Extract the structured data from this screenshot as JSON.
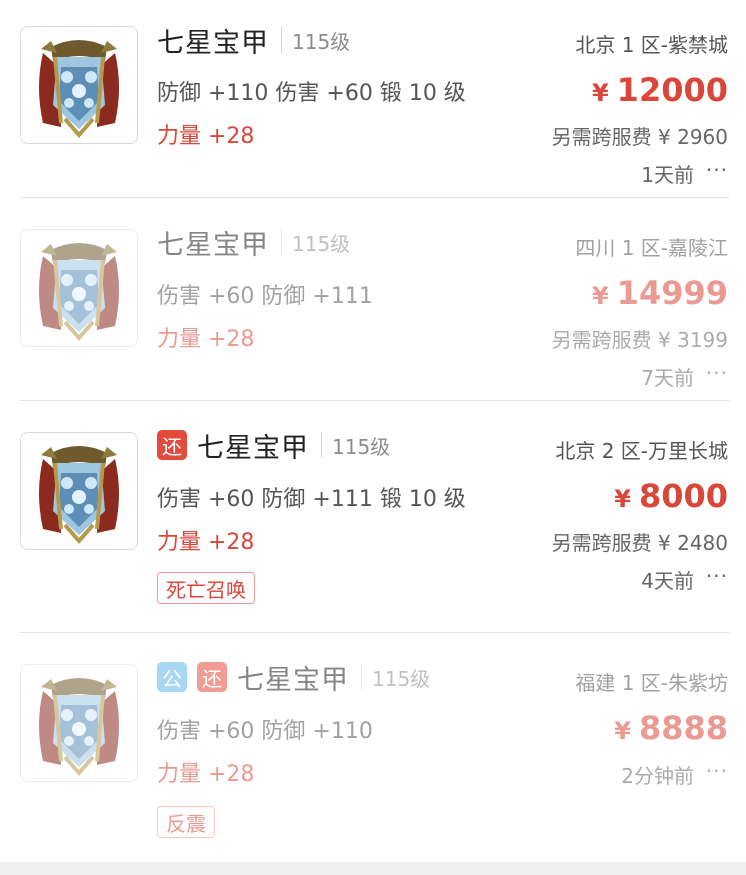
{
  "listings": [
    {
      "title": "七星宝甲",
      "level": "115级",
      "attrs": "防御 +110 伤害 +60 锻 10 级",
      "power": "力量 +28",
      "server": "北京 1 区-紫禁城",
      "currency": "¥",
      "price": "12000",
      "fee": "另需跨服费 ¥ 2960",
      "time": "1天前",
      "more": "···"
    },
    {
      "title": "七星宝甲",
      "level": "115级",
      "attrs": "伤害 +60 防御 +111",
      "power": "力量 +28",
      "server": "四川 1 区-嘉陵江",
      "currency": "¥",
      "price": "14999",
      "fee": "另需跨服费 ¥ 3199",
      "time": "7天前",
      "more": "···"
    },
    {
      "tags": [
        "还"
      ],
      "title": "七星宝甲",
      "level": "115级",
      "attrs": "伤害 +60 防御 +111 锻 10 级",
      "power": "力量 +28",
      "skill": "死亡召唤",
      "server": "北京 2 区-万里长城",
      "currency": "¥",
      "price": "8000",
      "fee": "另需跨服费 ¥ 2480",
      "time": "4天前",
      "more": "···"
    },
    {
      "tags": [
        "公",
        "还"
      ],
      "title": "七星宝甲",
      "level": "115级",
      "attrs": "伤害 +60 防御 +110",
      "power": "力量 +28",
      "skill": "反震",
      "server": "福建 1 区-朱紫坊",
      "currency": "¥",
      "price": "8888",
      "time": "2分钟前",
      "more": "···"
    }
  ],
  "colors": {
    "accent": "#d9473b",
    "tag_return": "#e24b3b",
    "tag_public": "#5fb7e8"
  },
  "icons": {
    "thumbnail": "armor-icon",
    "more": "more-icon"
  }
}
